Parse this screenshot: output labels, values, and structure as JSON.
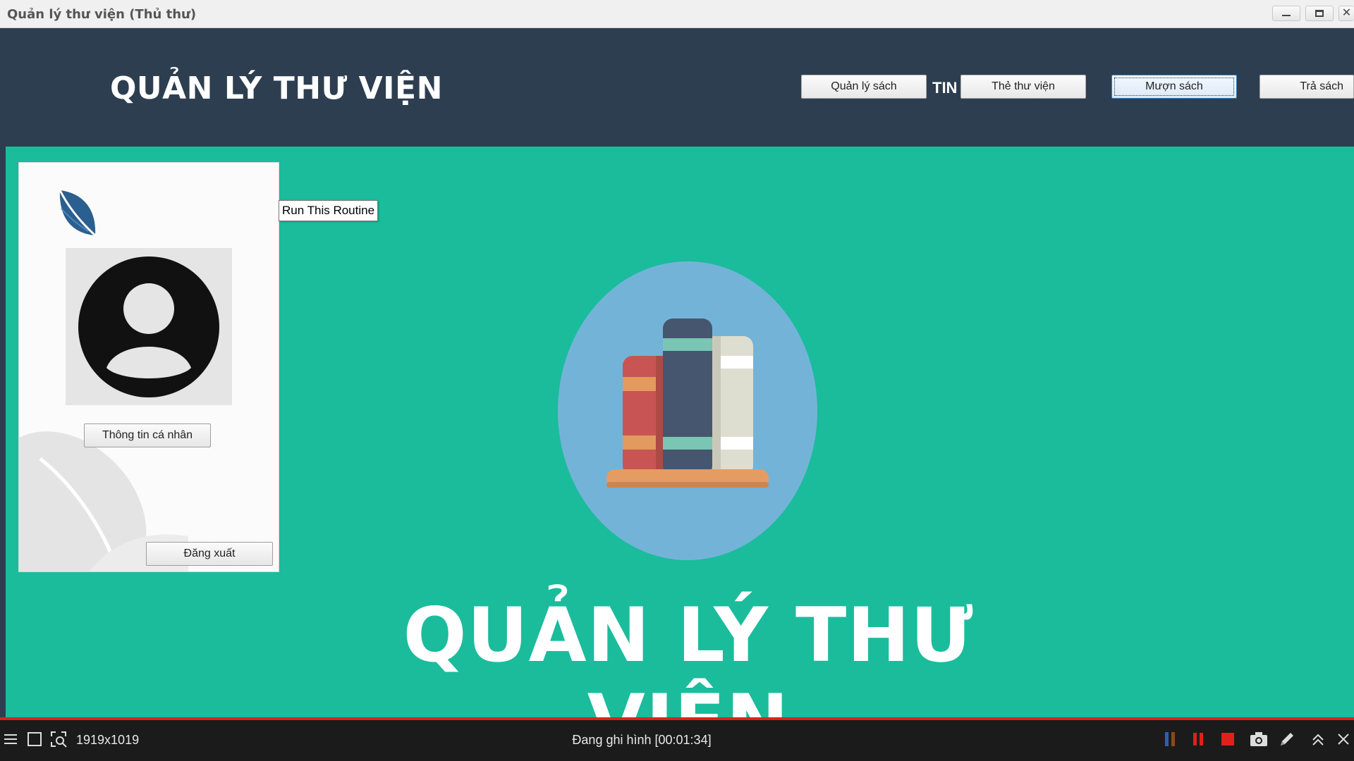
{
  "window": {
    "title": "Quản lý thư viện (Thủ thư)",
    "controls": {
      "minimize": "minimize-icon",
      "maximize": "maximize-icon",
      "close": "close-icon"
    }
  },
  "header": {
    "app_title": "QUẢN LÝ THƯ VIỆN",
    "partial_label": "TIN",
    "nav": [
      {
        "label": "Quản lý sách"
      },
      {
        "label": "Thẻ thư viện"
      },
      {
        "label": "Mượn sách"
      },
      {
        "label": "Trả sách"
      }
    ],
    "active_nav": "Mượn sách"
  },
  "user_panel": {
    "logo_icon": "leaf-icon",
    "avatar_icon": "user-avatar-icon",
    "profile_button": "Thông tin cá nhân",
    "logout_button": "Đăng xuất"
  },
  "tooltip": {
    "text": "Run This Routine"
  },
  "main": {
    "illustration_icon": "books-on-shelf-icon",
    "big_title": "QUẢN LÝ THƯ VIỆN"
  },
  "recorder": {
    "resolution": "1919x1019",
    "status": "Đang ghi hình [00:01:34]",
    "icons": [
      "menu-icon",
      "region-icon",
      "zoom-icon",
      "pause-icon",
      "stop-icon",
      "camera-icon",
      "pen-icon",
      "collapse-icon",
      "close-icon"
    ]
  },
  "colors": {
    "header_bg": "#2d3e50",
    "main_bg": "#1abc9c",
    "circle": "#74b3d8",
    "recording_red": "#e0201b"
  }
}
